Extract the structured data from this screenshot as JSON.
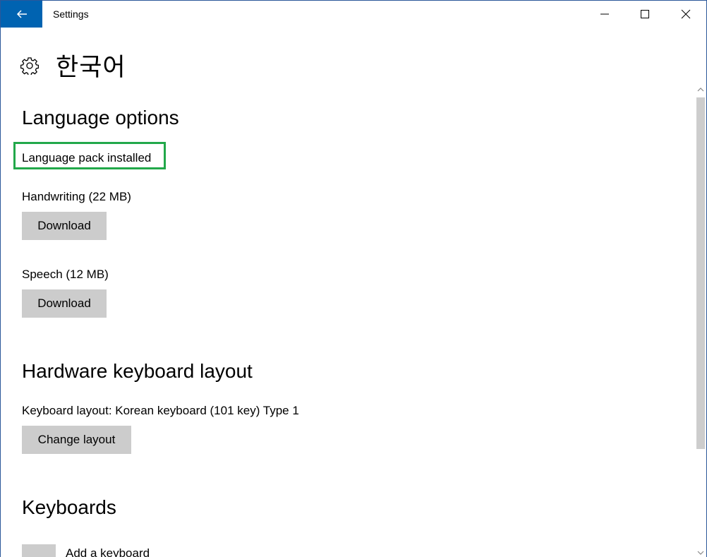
{
  "window": {
    "title": "Settings"
  },
  "header": {
    "title": "한국어"
  },
  "language_options": {
    "heading": "Language options",
    "status": "Language pack installed",
    "handwriting_label": "Handwriting (22 MB)",
    "handwriting_button": "Download",
    "speech_label": "Speech (12 MB)",
    "speech_button": "Download"
  },
  "hardware_keyboard": {
    "heading": "Hardware keyboard layout",
    "layout_label": "Keyboard layout:  Korean keyboard (101 key) Type 1",
    "change_button": "Change layout"
  },
  "keyboards": {
    "heading": "Keyboards",
    "add_label": "Add a keyboard"
  },
  "colors": {
    "accent": "#0063b1",
    "button_bg": "#cccccc",
    "highlight": "#22a84a"
  },
  "icons": {
    "back": "back-arrow-icon",
    "settings": "gear-icon",
    "minimize": "minimize-icon",
    "maximize": "maximize-icon",
    "close": "close-icon"
  }
}
